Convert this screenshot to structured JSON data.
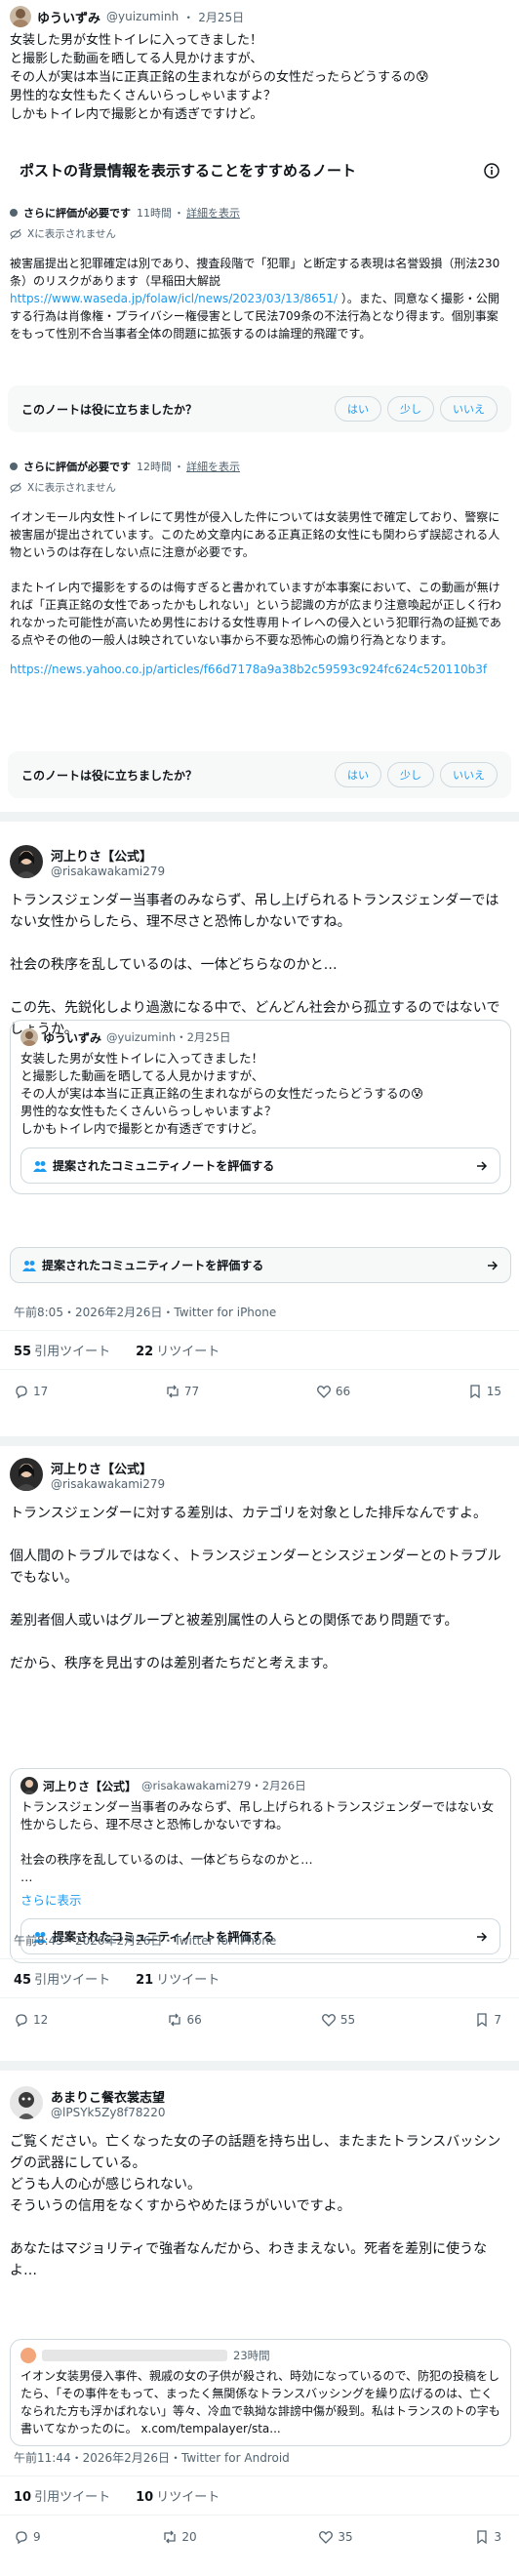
{
  "top_tweet": {
    "name": "ゆういずみ",
    "handle": "@yuizuminh",
    "date": "2月25日",
    "text": "女装した男が女性トイレに入ってきました！\nと撮影した動画を晒してる人見かけますが、\nその人が実は本当に正真正銘の生まれながらの女性だったらどうするの😰\n男性的な女性もたくさんいらっしゃいますよ？\nしかもトイレ内で撮影とか有透ぎですけど。",
    "note_header": "ポストの背景情報を表示することをすすめるノート"
  },
  "notes": [
    {
      "rating_label": "さらに評価が必要です",
      "time": "11時間",
      "detail_link": "詳細を表示",
      "shown_label": "Xに表示されません",
      "text_a": "被害届提出と犯罪確定は別であり、捜査段階で「犯罪」と断定する表現は名誉毀損（刑法230条）のリスクがあります（早稲田大解説",
      "url": "https://www.waseda.jp/folaw/icl/news/2023/03/13/8651/",
      "text_b": "）。また、同意なく撮影・公開する行為は肖像権・プライバシー権侵害として民法709条の不法行為となり得ます。個別事案をもって性別不合当事者全体の問題に拡張するのは論理的飛躍です。",
      "help_q": "このノートは役に立ちましたか？",
      "btn_yes": "はい",
      "btn_some": "少し",
      "btn_no": "いいえ"
    },
    {
      "rating_label": "さらに評価が必要です",
      "time": "12時間",
      "detail_link": "詳細を表示",
      "shown_label": "Xに表示されません",
      "text_a": "イオンモール内女性トイレにて男性が侵入した件については女装男性で確定しており、警察に被害届が提出されています。このため文章内にある正真正銘の女性にも関わらず誤認される人物というのは存在しない点に注意が必要です。\n\nまたトイレ内で撮影をするのは侮すぎると書かれていますが本事案において、この動画が無ければ「正真正銘の女性であったかもしれない」という認識の方が広まり注意喚起が正しく行われなかった可能性が高いため男性における女性専用トイレへの侵入という犯罪行為の証拠である点やその他の一般人は映されていない事から不要な恐怖心の煽り行為となります。",
      "url": "https://news.yahoo.co.jp/articles/f66d7178a9a38b2c59593c924fc624c520110b3f",
      "help_q": "このノートは役に立ちましたか？",
      "btn_yes": "はい",
      "btn_some": "少し",
      "btn_no": "いいえ"
    }
  ],
  "tweet2": {
    "name": "河上りさ【公式】",
    "handle": "@risakawakami279",
    "text": "トランスジェンダー当事者のみならず、吊し上げられるトランスジェンダーではない女性からしたら、理不尽さと恐怖しかないですね。\n\n社会の秩序を乱しているのは、一体どちらなのかと…\n\nこの先、先鋭化しより過激になる中で、どんどん社会から孤立するのではないでしょうか。",
    "quote_name": "ゆういずみ",
    "quote_handle": "@yuizuminh・2月25日",
    "quote_text": "女装した男が女性トイレに入ってきました！\nと撮影した動画を晒してる人見かけますが、\nその人が実は本当に正真正銘の生まれながらの女性だったらどうするの😰\n男性的な女性もたくさんいらっしゃいますよ？\nしかもトイレ内で撮影とか有透ぎですけど。",
    "comm_btn_1": "提案されたコミュニティノートを評価する",
    "comm_btn_2": "提案されたコミュニティノートを評価する",
    "meta": "午前8:05・2026年2月26日・Twitter for iPhone",
    "quotes_count": "55",
    "quotes_label": "引用ツイート",
    "retweets_count": "22",
    "retweets_label": "リツイート",
    "replies": "17",
    "rts": "77",
    "likes": "66",
    "bookmarks": "15"
  },
  "tweet3": {
    "name": "河上りさ【公式】",
    "handle": "@risakawakami279",
    "text": "トランスジェンダーに対する差別は、カテゴリを対象とした排斥なんですよ。\n\n個人間のトラブルではなく、トランスジェンダーとシスジェンダーとのトラブルでもない。\n\n差別者個人或いはグループと被差別属性の人らとの関係であり問題です。\n\nだから、秩序を見出すのは差別者たちだと考えます。",
    "quote_name": "河上りさ【公式】",
    "quote_handle": "@risakawakami279・2月26日",
    "quote_text": "トランスジェンダー当事者のみならず、吊し上げられるトランスジェンダーではない女性からしたら、理不尽さと恐怖しかないですね。\n\n社会の秩序を乱しているのは、一体どちらなのかと…\n…",
    "show_more": "さらに表示",
    "comm_btn": "提案されたコミュニティノートを評価する",
    "meta": "午前8:45・2026年2月26日・Twitter for iPhone",
    "quotes_count": "45",
    "quotes_label": "引用ツイート",
    "retweets_count": "21",
    "retweets_label": "リツイート",
    "replies": "12",
    "rts": "66",
    "likes": "55",
    "bookmarks": "7"
  },
  "tweet4": {
    "name": "あまりこ餐衣裳志望",
    "handle": "@lPSYk5Zy8f78220",
    "text": "ご覧ください。亡くなった女の子の話題を持ち出し、またまたトランスバッシングの武器にしている。\nどうも人の心が感じられない。\nそういうの信用をなくすからやめたほうがいいですよ。\n\nあなたはマジョリティで強者なんだから、わきまえない。死者を差別に使うなよ…",
    "quote_time": "23時間",
    "quote_text": "イオン女装男侵入事件、親戚の女の子供が殺され、時効になっているので、防犯の投稿をしたら、「その事件をもって、まったく無関係なトランスバッシングを繰り広げるのは、亡くなられた方も浮かばれない」等々、冷血で執拗な誹謗中傷が殺到。私はトランスのトの字も書いてなかったのに。 x.com/tempalayer/sta...",
    "meta": "午前11:44・2026年2月26日・Twitter for Android",
    "quotes_count": "10",
    "quotes_label": "引用ツイート",
    "retweets_count": "10",
    "retweets_label": "リツイート",
    "replies": "9",
    "rts": "20",
    "likes": "35",
    "bookmarks": "3"
  },
  "colors": {
    "link": "#1d9bf0",
    "muted": "#536471",
    "border": "#cfd9de"
  }
}
